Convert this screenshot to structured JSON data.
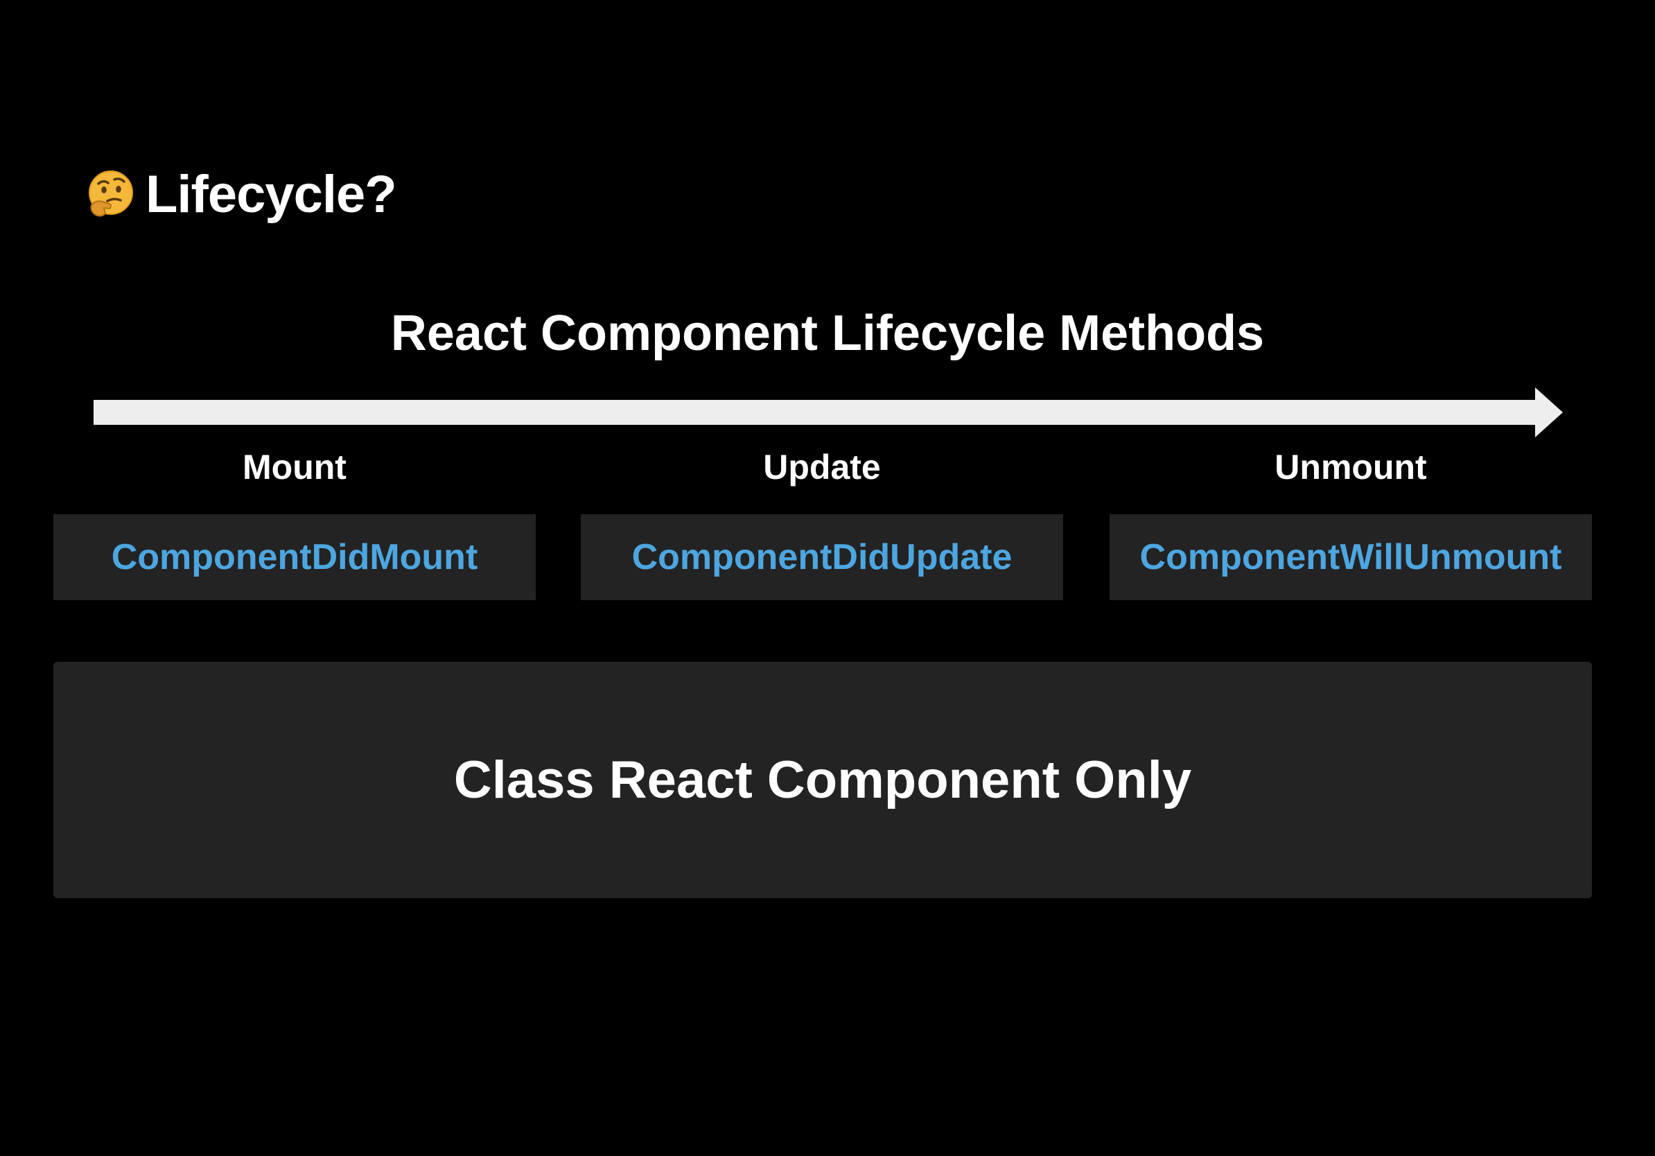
{
  "header": {
    "emoji_icon": "thinking-face-icon",
    "title": "Lifecycle?"
  },
  "diagram": {
    "title": "React Component Lifecycle Methods",
    "arrow_color": "#eeeeee",
    "method_color": "#4da6e0",
    "box_color": "#232323",
    "phases": [
      {
        "label": "Mount",
        "method": "ComponentDidMount"
      },
      {
        "label": "Update",
        "method": "ComponentDidUpdate"
      },
      {
        "label": "Unmount",
        "method": "ComponentWillUnmount"
      }
    ],
    "note": "Class React Component Only"
  }
}
